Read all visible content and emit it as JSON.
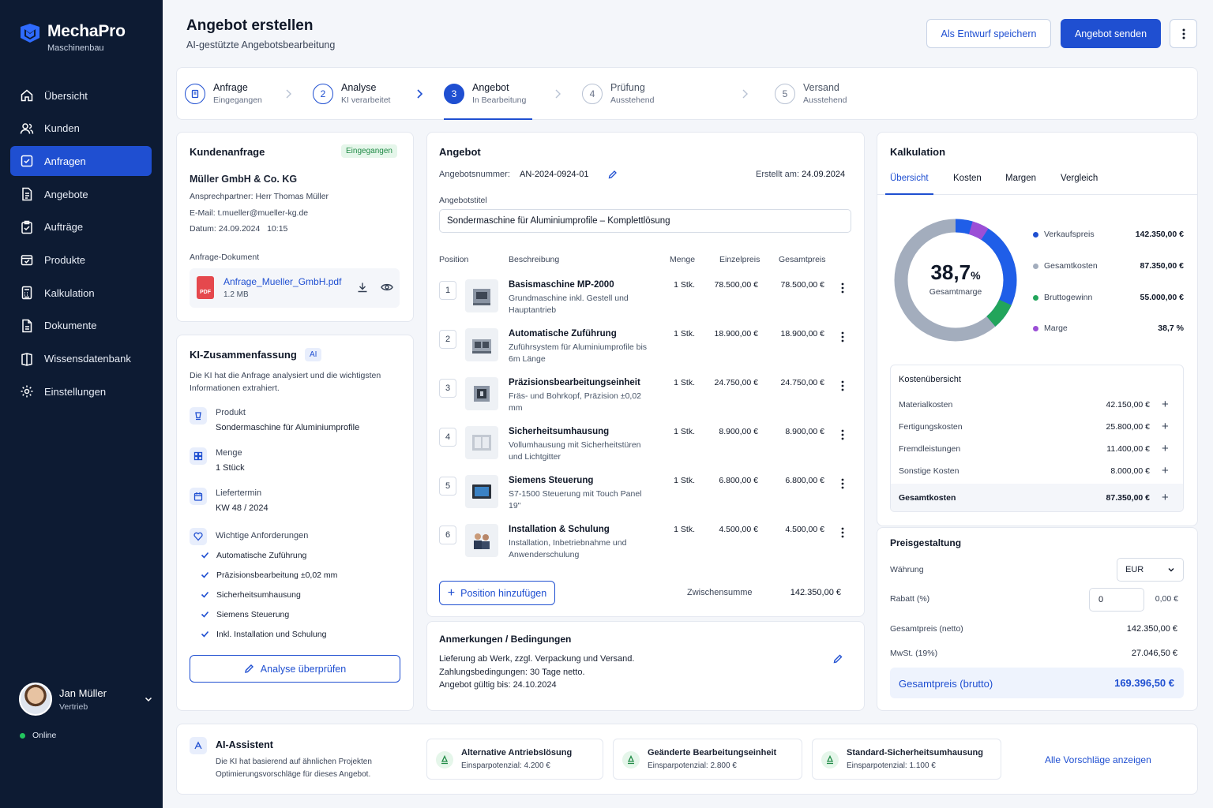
{
  "app": {
    "name": "MechaPro",
    "subtitle": "Maschinenbau"
  },
  "nav": [
    {
      "label": "Übersicht",
      "icon": "home-icon"
    },
    {
      "label": "Kunden",
      "icon": "users-icon"
    },
    {
      "label": "Anfragen",
      "icon": "inbox-icon",
      "active": true
    },
    {
      "label": "Angebote",
      "icon": "document-icon"
    },
    {
      "label": "Aufträge",
      "icon": "clipboard-icon"
    },
    {
      "label": "Produkte",
      "icon": "box-icon"
    },
    {
      "label": "Kalkulation",
      "icon": "calculator-icon"
    },
    {
      "label": "Dokumente",
      "icon": "file-icon"
    },
    {
      "label": "Wissensdatenbank",
      "icon": "book-icon"
    },
    {
      "label": "Einstellungen",
      "icon": "gear-icon"
    }
  ],
  "user": {
    "name": "Jan Müller",
    "role": "Vertrieb",
    "status": "Online"
  },
  "header": {
    "title": "Angebot erstellen",
    "subtitle": "AI-gestützte Angebotsbearbeitung",
    "save_draft": "Als Entwurf speichern",
    "send": "Angebot senden"
  },
  "steps": [
    {
      "num": "",
      "title": "Anfrage",
      "status": "Eingegangen"
    },
    {
      "num": "2",
      "title": "Analyse",
      "status": "KI verarbeitet"
    },
    {
      "num": "3",
      "title": "Angebot",
      "status": "In Bearbeitung"
    },
    {
      "num": "4",
      "title": "Prüfung",
      "status": "Ausstehend"
    },
    {
      "num": "5",
      "title": "Versand",
      "status": "Ausstehend"
    }
  ],
  "request": {
    "title": "Kundenanfrage",
    "badge": "Eingegangen",
    "company": "Müller GmbH & Co. KG",
    "contact": "Ansprechpartner: Herr Thomas Müller",
    "email_label": "E-Mail:",
    "email": "t.mueller@mueller-kg.de",
    "date_label": "Datum:",
    "date": "24.09.2024",
    "time": "10:15",
    "doc_label": "Anfrage-Dokument",
    "doc_name": "Anfrage_Mueller_GmbH.pdf",
    "doc_size": "1.2 MB",
    "doc_type": "PDF"
  },
  "summary": {
    "title": "KI-Zusammenfassung",
    "badge": "AI",
    "intro": "Die KI hat die Anfrage analysiert und die wichtigsten Informationen extrahiert.",
    "product_label": "Produkt",
    "product": "Sondermaschine für Aluminiumprofile",
    "qty_label": "Menge",
    "qty": "1 Stück",
    "delivery_label": "Liefertermin",
    "delivery": "KW 48 / 2024",
    "req_label": "Wichtige Anforderungen",
    "requirements": [
      "Automatische Zuführung",
      "Präzisionsbearbeitung ±0,02 mm",
      "Sicherheitsumhausung",
      "Siemens Steuerung",
      "Inkl. Installation und Schulung"
    ],
    "review_button": "Analyse überprüfen"
  },
  "offer": {
    "title": "Angebot",
    "number_label": "Angebotsnummer:",
    "number": "AN-2024-0924-01",
    "created_label": "Erstellt am:",
    "created": "24.09.2024",
    "title_label": "Angebotstitel",
    "title_value": "Sondermaschine für Aluminiumprofile – Komplettlösung",
    "columns": [
      "Position",
      "Beschreibung",
      "Menge",
      "Einzelpreis",
      "Gesamtpreis"
    ],
    "items": [
      {
        "pos": "1",
        "name": "Basismaschine MP-2000",
        "desc": "Grundmaschine inkl. Gestell und Hauptantrieb",
        "qty": "1 Stk.",
        "unit": "78.500,00 €",
        "total": "78.500,00 €"
      },
      {
        "pos": "2",
        "name": "Automatische Zuführung",
        "desc": "Zuführsystem für Aluminiumprofile bis 6m Länge",
        "qty": "1 Stk.",
        "unit": "18.900,00 €",
        "total": "18.900,00 €"
      },
      {
        "pos": "3",
        "name": "Präzisionsbearbeitungseinheit",
        "desc": "Fräs- und Bohrkopf, Präzision ±0,02 mm",
        "qty": "1 Stk.",
        "unit": "24.750,00 €",
        "total": "24.750,00 €"
      },
      {
        "pos": "4",
        "name": "Sicherheitsumhausung",
        "desc": "Vollumhausung mit Sicherheitstüren und Lichtgitter",
        "qty": "1 Stk.",
        "unit": "8.900,00 €",
        "total": "8.900,00 €"
      },
      {
        "pos": "5",
        "name": "Siemens Steuerung",
        "desc": "S7-1500 Steuerung mit Touch Panel 19\"",
        "qty": "1 Stk.",
        "unit": "6.800,00 €",
        "total": "6.800,00 €"
      },
      {
        "pos": "6",
        "name": "Installation & Schulung",
        "desc": "Installation, Inbetriebnahme und Anwenderschulung",
        "qty": "1 Stk.",
        "unit": "4.500,00 €",
        "total": "4.500,00 €"
      }
    ],
    "add_button": "Position hinzufügen",
    "subtotal_label": "Zwischensumme",
    "subtotal": "142.350,00 €"
  },
  "notes": {
    "title": "Anmerkungen / Bedingungen",
    "lines": [
      "Lieferung ab Werk, zzgl. Verpackung und Versand.",
      "Zahlungsbedingungen: 30 Tage netto.",
      "Angebot gültig bis: 24.10.2024"
    ]
  },
  "calc": {
    "title": "Kalkulation",
    "tabs": [
      "Übersicht",
      "Kosten",
      "Margen",
      "Vergleich"
    ],
    "donut_value": "38,7",
    "donut_unit": "%",
    "donut_label": "Gesamtmarge",
    "legend": [
      {
        "label": "Verkaufspreis",
        "value": "142.350,00 €",
        "color": "#1f4fd1"
      },
      {
        "label": "Gesamtkosten",
        "value": "87.350,00 €",
        "color": "#a3adbd"
      },
      {
        "label": "Bruttogewinn",
        "value": "55.000,00 €",
        "color": "#22a55b"
      },
      {
        "label": "Marge",
        "value": "38,7 %",
        "color": "#9b4fd6"
      }
    ],
    "cost_title": "Kostenübersicht",
    "costs": [
      {
        "label": "Materialkosten",
        "value": "42.150,00 €"
      },
      {
        "label": "Fertigungskosten",
        "value": "25.800,00 €"
      },
      {
        "label": "Fremdleistungen",
        "value": "11.400,00 €"
      },
      {
        "label": "Sonstige Kosten",
        "value": "8.000,00 €"
      }
    ],
    "cost_total_label": "Gesamtkosten",
    "cost_total": "87.350,00 €"
  },
  "pricing": {
    "title": "Preisgestaltung",
    "currency_label": "Währung",
    "currency": "EUR",
    "discount_label": "Rabatt (%)",
    "discount": "0",
    "discount_amount": "0,00 €",
    "net_label": "Gesamtpreis (netto)",
    "net": "142.350,00 €",
    "vat_label": "MwSt. (19%)",
    "vat": "27.046,50 €",
    "gross_label": "Gesamtpreis (brutto)",
    "gross": "169.396,50 €"
  },
  "assistant": {
    "title": "AI-Assistent",
    "text": "Die KI hat basierend auf ähnlichen Projekten Optimierungsvorschläge für dieses Angebot.",
    "suggestions": [
      {
        "title": "Alternative Antriebslösung",
        "savings": "Einsparpotenzial: 4.200 €"
      },
      {
        "title": "Geänderte Bearbeitungseinheit",
        "savings": "Einsparpotenzial: 2.800 €"
      },
      {
        "title": "Standard-Sicherheitsumhausung",
        "savings": "Einsparpotenzial: 1.100 €"
      }
    ],
    "all_link": "Alle Vorschläge anzeigen"
  }
}
